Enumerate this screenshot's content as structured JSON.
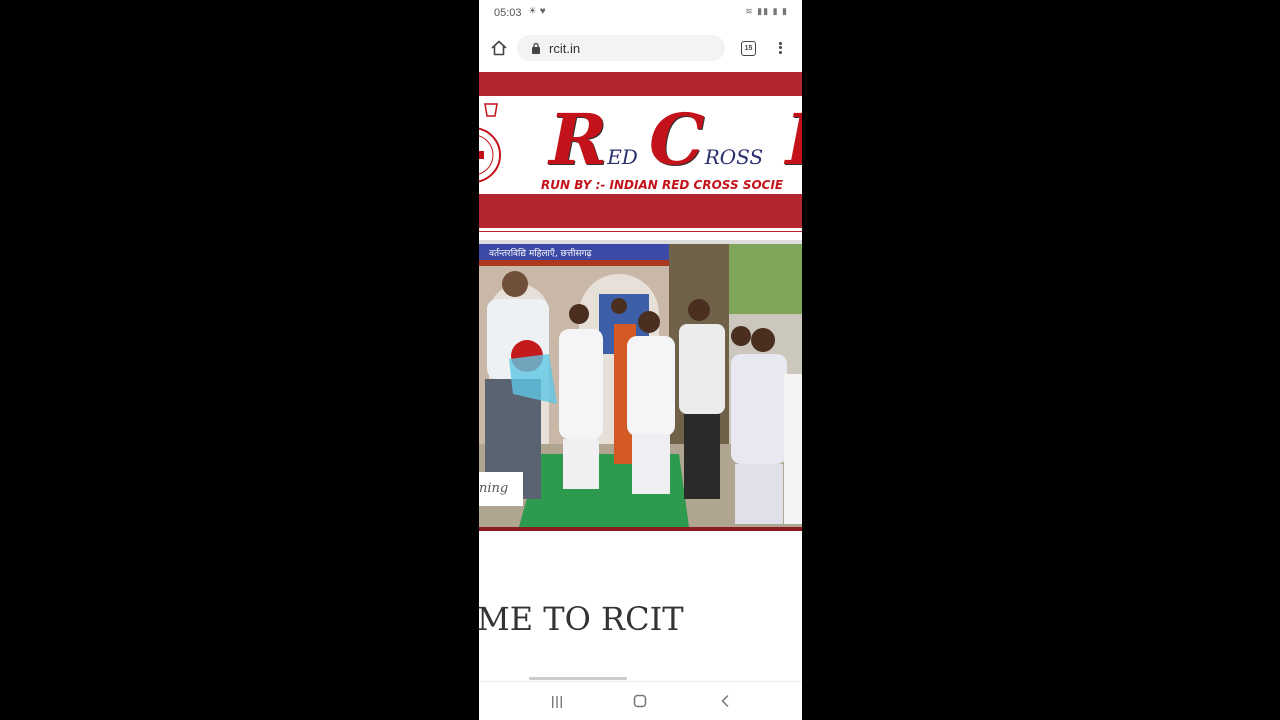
{
  "status_bar": {
    "time": "05:03",
    "left_icons": "☀ ♥",
    "right_icons": "≋ ▮▮ ▮ ▮"
  },
  "browser": {
    "url": "rcit.in",
    "tab_count": "15"
  },
  "site": {
    "brand_r": "R",
    "brand_ed": "ED",
    "brand_c": "C",
    "brand_ross": "ROSS",
    "brand_next": "I",
    "tagline": "RUN BY :- INDIAN RED CROSS SOCIE",
    "banner_text": "वर्तन्तरविद्यि महिलाएँ, छत्तीसगढ़",
    "slide_caption": "ning",
    "welcome": "ME TO RCIT"
  },
  "colors": {
    "brand_red": "#b4252f",
    "brand_blue": "#2a2f6e"
  }
}
